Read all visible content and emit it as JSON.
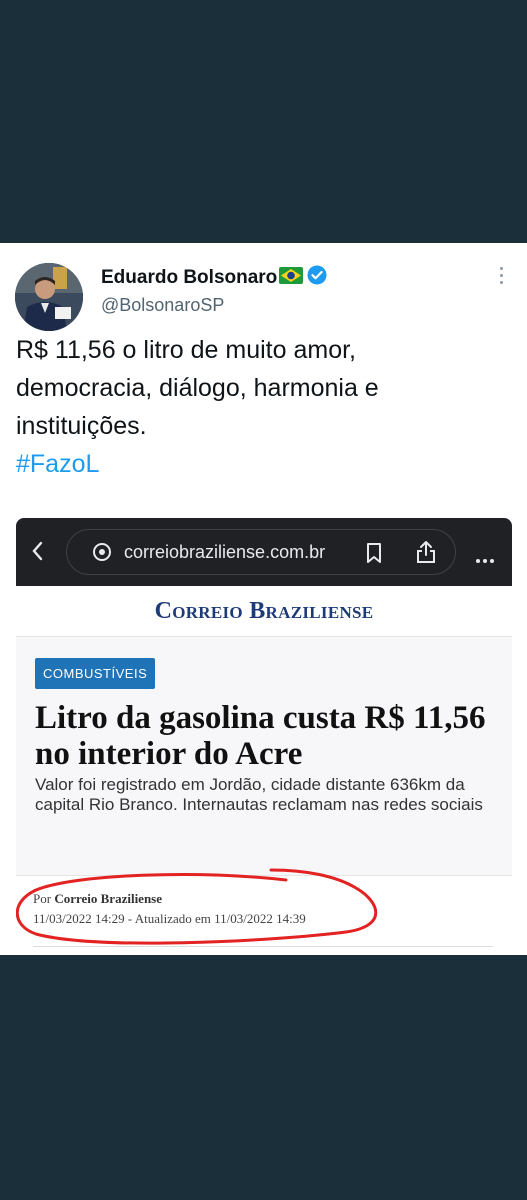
{
  "tweet": {
    "author_name": "Eduardo Bolsonaro",
    "handle": "@BolsonaroSP",
    "flag_icon": "brazil-flag-icon",
    "verified_icon": "verified-badge-icon",
    "text_lines": [
      "R$ 11,56 o litro de muito amor,",
      "democracia, diálogo, harmonia e",
      "instituições."
    ],
    "hashtag": "#FazoL",
    "colors": {
      "link": "#1d9bf0",
      "verified": "#1d9bf0"
    }
  },
  "embedded_screenshot": {
    "url": "correiobraziliense.com.br",
    "site_logo": "Correio Braziliense",
    "category_badge": "COMBUSTÍVEIS",
    "headline": "Litro da gasolina custa R$ 11,56 no interior do Acre",
    "subheadline": "Valor foi registrado em Jordão, cidade distante 636km da capital Rio Branco. Internautas reclamam nas redes sociais",
    "byline_prefix": "Por",
    "byline_author": "Correio Braziliense",
    "dates": "11/03/2022 14:29 - Atualizado em 11/03/2022 14:39",
    "annotation_color": "#e32222",
    "colors": {
      "badge": "#1f73b7",
      "logo": "#1d3b78"
    }
  }
}
